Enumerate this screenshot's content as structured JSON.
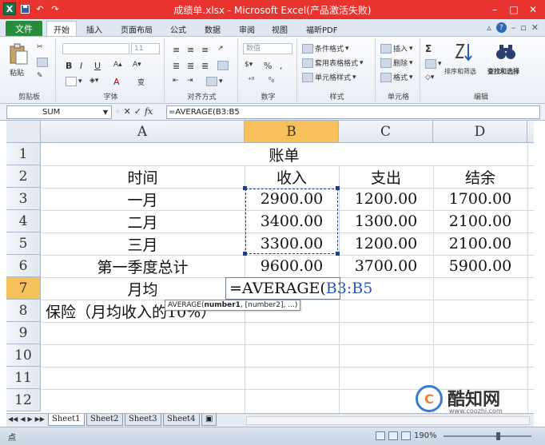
{
  "window": {
    "title": "成绩单.xlsx - Microsoft Excel(产品激活失败)",
    "app_icon_letter": "X",
    "controls": {
      "minimize": "–",
      "restore": "□",
      "close": "✕"
    },
    "title_bar_color": "#e8332f"
  },
  "quick_access": {
    "undo": "↶",
    "redo": "↷"
  },
  "ribbon_tabs": [
    "开始",
    "插入",
    "页面布局",
    "公式",
    "数据",
    "审阅",
    "视图",
    "福昕PDF"
  ],
  "file_tab": "文件",
  "active_tab": "开始",
  "ribbon_groups": {
    "clipboard": {
      "label": "剪贴板",
      "paste": "粘贴"
    },
    "font": {
      "label": "字体",
      "bold": "B",
      "italic": "I",
      "underline": "U",
      "size_placeholder": "11",
      "font_color": "A",
      "phonetic": "变"
    },
    "alignment": {
      "label": "对齐方式"
    },
    "number": {
      "label": "数字",
      "format": "数值",
      "percent": "%",
      "comma": ","
    },
    "styles": {
      "label": "样式",
      "conditional": "条件格式",
      "table": "套用表格格式",
      "cell_styles": "单元格样式"
    },
    "cells": {
      "label": "单元格",
      "insert": "插入",
      "delete": "删除",
      "format": "格式"
    },
    "editing": {
      "label": "编辑",
      "sum": "Σ",
      "sort_filter": "排序和筛选",
      "find_select": "查找和选择"
    }
  },
  "formula_bar": {
    "name_box": "SUM",
    "cancel": "✕",
    "enter": "✓",
    "fx": "fx",
    "formula": "=AVERAGE(B3:B5"
  },
  "columns": [
    "A",
    "B",
    "C",
    "D"
  ],
  "rows": [
    "1",
    "2",
    "3",
    "4",
    "5",
    "6",
    "7",
    "8",
    "9",
    "10",
    "11",
    "12"
  ],
  "sheet": {
    "title": "账单",
    "headers": [
      "时间",
      "收入",
      "支出",
      "结余"
    ],
    "data": [
      [
        "一月",
        "2900.00",
        "1200.00",
        "1700.00"
      ],
      [
        "二月",
        "3400.00",
        "1300.00",
        "2100.00"
      ],
      [
        "三月",
        "3300.00",
        "1200.00",
        "2100.00"
      ],
      [
        "第一季度总计",
        "9600.00",
        "3700.00",
        "5900.00"
      ]
    ],
    "row7_label": "月均",
    "row8_label": "保险（月均收入的10%）",
    "editing_formula_prefix": "=AVERAGE(",
    "editing_formula_ref": "B3:B5",
    "tooltip_fn": "AVERAGE(",
    "tooltip_arg1": "number1",
    "tooltip_rest": ", [number2], ...)"
  },
  "sheet_tabs": [
    "Sheet1",
    "Sheet2",
    "Sheet3",
    "Sheet4"
  ],
  "active_sheet": "Sheet1",
  "status": {
    "mode": "点",
    "zoom": "190%",
    "zoom_level": 0.62
  },
  "watermark": {
    "brand": "酷知网",
    "url": "www.coozhi.com",
    "logo_letter": "C"
  }
}
